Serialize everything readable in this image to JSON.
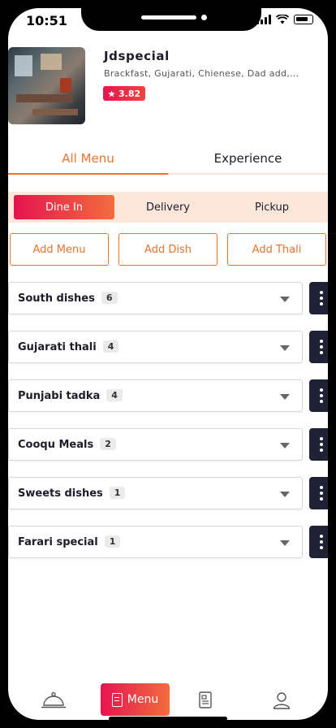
{
  "status_bar": {
    "time": "10:51"
  },
  "restaurant": {
    "name": "Jdspecial",
    "description": "Brackfast, Gujarati, Chienese, Dad add,...",
    "rating": "3.82",
    "rating_icon": "star-icon"
  },
  "main_tabs": [
    {
      "label": "All Menu",
      "active": true
    },
    {
      "label": "Experience",
      "active": false
    }
  ],
  "sub_tabs": [
    {
      "label": "Dine In",
      "active": true
    },
    {
      "label": "Delivery",
      "active": false
    },
    {
      "label": "Pickup",
      "active": false
    }
  ],
  "actions": {
    "add_menu": "Add Menu",
    "add_dish": "Add Dish",
    "add_thali": "Add Thali"
  },
  "categories": [
    {
      "name": "South dishes",
      "count": "6"
    },
    {
      "name": "Gujarati thali",
      "count": "4"
    },
    {
      "name": "Punjabi tadka",
      "count": "4"
    },
    {
      "name": "Cooqu Meals",
      "count": "2"
    },
    {
      "name": "Sweets dishes",
      "count": "1"
    },
    {
      "name": "Farari special",
      "count": "1"
    }
  ],
  "bottom_nav": {
    "items": [
      {
        "icon": "cloche-icon",
        "label": ""
      },
      {
        "icon": "menu-book-icon",
        "label": "Menu",
        "active": true
      },
      {
        "icon": "orders-icon",
        "label": ""
      },
      {
        "icon": "profile-icon",
        "label": ""
      }
    ]
  },
  "colors": {
    "accent": "#e8742e",
    "gradient_start": "#e5144f",
    "gradient_end": "#f26d3d",
    "dark_button": "#1f2235",
    "sub_tab_bg": "#fde7da"
  }
}
